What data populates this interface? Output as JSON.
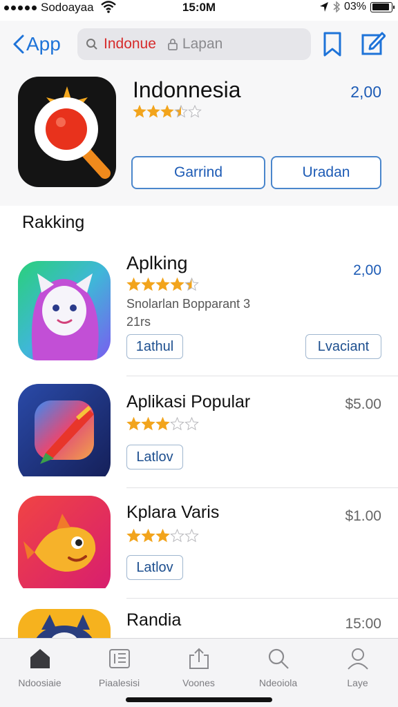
{
  "status_bar": {
    "carrier": "Sodoayaa",
    "time": "15:0M",
    "battery": "03%",
    "battery_level": 0.9
  },
  "nav": {
    "back_label": "App",
    "search_term": "Indonue",
    "search_place": "Lapan",
    "icons": [
      "chevron-left-icon",
      "search-icon",
      "lock-icon",
      "bookmark-icon",
      "edit-icon"
    ]
  },
  "hero": {
    "title": "Indonnesia",
    "price": "2,00",
    "rating": 3.5,
    "button_1": "Garrind",
    "button_2": "Uradan",
    "accent": "#1d5bb5"
  },
  "section_title": "Rakking",
  "apps": [
    {
      "name": "Aplking",
      "price": "2,00",
      "price_color": "#1d5bb5",
      "rating": 4.5,
      "subtitle_1": "Snolarlan Bopparant 3",
      "subtitle_2": "21rs",
      "tag": "1athul",
      "tag_2": "Lvaciant"
    },
    {
      "name": "Aplikasi Popular",
      "price": "$5.00",
      "price_color": "#666666",
      "rating": 3.0,
      "tag": "Latlov"
    },
    {
      "name": "Kplara Varis",
      "price": "$1.00",
      "price_color": "#666666",
      "rating": 3.0,
      "tag": "Latlov"
    },
    {
      "name": "Randia",
      "price": "15:00",
      "price_color": "#666666"
    }
  ],
  "tabs": [
    {
      "label": "Ndoosiaie",
      "icon": "home-icon",
      "active": true
    },
    {
      "label": "Piaalesisi",
      "icon": "list-icon",
      "active": false
    },
    {
      "label": "Voones",
      "icon": "share-icon",
      "active": false
    },
    {
      "label": "Ndeoiola",
      "icon": "search-icon",
      "active": false
    },
    {
      "label": "Laye",
      "icon": "person-icon",
      "active": false
    }
  ]
}
